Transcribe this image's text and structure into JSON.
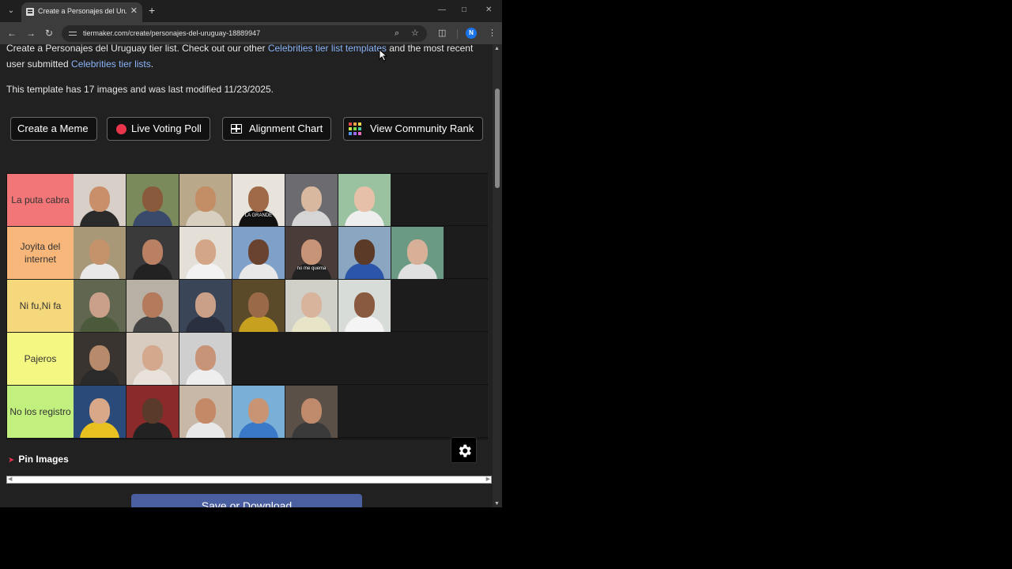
{
  "browser": {
    "tab_title": "Create a Personajes del Uruguay",
    "url": "tiermaker.com/create/personajes-del-uruguay-18889947",
    "profile_initial": "N"
  },
  "page": {
    "intro_lead": "Create a Personajes del Uruguay tier list. Check out our other ",
    "intro_link1": "Celebrities tier list templates",
    "intro_mid": " and the most recent user submitted ",
    "intro_link2": "Celebrities tier lists",
    "intro_end": ".",
    "template_info": "This template has 17 images and was last modified 11/23/2025."
  },
  "buttons": {
    "meme": "Create a Meme",
    "poll": "Live Voting Poll",
    "alignment": "Alignment Chart",
    "rank": "View Community Rank"
  },
  "tiers": [
    {
      "label": "La puta cabra",
      "color": "#f27577",
      "tiles": [
        {
          "bg": "#d8d0c8",
          "skin": "#c98f6a",
          "shirt": "#2a2a2a"
        },
        {
          "bg": "#7a8a5a",
          "skin": "#8a5a3c",
          "shirt": "#3a4a6a"
        },
        {
          "bg": "#b9a88a",
          "skin": "#c38d66",
          "shirt": "#d8cfc0"
        },
        {
          "bg": "#e8e4dc",
          "skin": "#a06a48",
          "shirt": "#111111",
          "caption": "LA GRANDE"
        },
        {
          "bg": "#6c6c70",
          "skin": "#d9b8a0",
          "shirt": "#d5d5d5"
        },
        {
          "bg": "#9ac2a0",
          "skin": "#e6c0a8",
          "shirt": "#eeeeee"
        }
      ]
    },
    {
      "label": "Joyita del internet",
      "color": "#f7b67a",
      "tiles": [
        {
          "bg": "#a89878",
          "skin": "#c4936c",
          "shirt": "#e8e8e8"
        },
        {
          "bg": "#3a3a3a",
          "skin": "#b98064",
          "shirt": "#222222"
        },
        {
          "bg": "#e4e0d8",
          "skin": "#d2a686",
          "shirt": "#f2f2f2"
        },
        {
          "bg": "#7fa0c8",
          "skin": "#6a4230",
          "shirt": "#e8e8e8"
        },
        {
          "bg": "#4a3c38",
          "skin": "#c89478",
          "shirt": "#222222",
          "caption": "no me quema"
        },
        {
          "bg": "#8aa6c0",
          "skin": "#5c3a28",
          "shirt": "#2a55a8"
        },
        {
          "bg": "#6a9a84",
          "skin": "#d8b098",
          "shirt": "#e0e0e0"
        }
      ]
    },
    {
      "label": "Ni fu,Ni fa",
      "color": "#f5d87c",
      "tiles": [
        {
          "bg": "#606650",
          "skin": "#caa08a",
          "shirt": "#4a5a3a"
        },
        {
          "bg": "#b8b0a4",
          "skin": "#b47a5c",
          "shirt": "#444444"
        },
        {
          "bg": "#3a4658",
          "skin": "#caa088",
          "shirt": "#2a3040"
        },
        {
          "bg": "#5a4a2a",
          "skin": "#9a6a48",
          "shirt": "#c8a020"
        },
        {
          "bg": "#d0d0c8",
          "skin": "#d8b49c",
          "shirt": "#e8e4c8"
        },
        {
          "bg": "#d8dcd8",
          "skin": "#8a5a40",
          "shirt": "#f4f4f4"
        }
      ]
    },
    {
      "label": "Pajeros",
      "color": "#f4f782",
      "tiles": [
        {
          "bg": "#3a3430",
          "skin": "#b88a6c",
          "shirt": "#2a2a2a"
        },
        {
          "bg": "#d8ccc0",
          "skin": "#d4a88c",
          "shirt": "#e8e2da"
        },
        {
          "bg": "#cfcfcf",
          "skin": "#c89478",
          "shirt": "#eeeeee"
        }
      ]
    },
    {
      "label": "No los registro",
      "color": "#c2f07e",
      "tiles": [
        {
          "bg": "#2a4a7a",
          "skin": "#d8a888",
          "shirt": "#e8c020"
        },
        {
          "bg": "#8a2a2a",
          "skin": "#5a3a2a",
          "shirt": "#222222"
        },
        {
          "bg": "#c8b8a8",
          "skin": "#c48a68",
          "shirt": "#e8e8e8"
        },
        {
          "bg": "#7ab0d8",
          "skin": "#c89474",
          "shirt": "#3a78c8"
        },
        {
          "bg": "#5a5048",
          "skin": "#c08a6c",
          "shirt": "#3a3a3a"
        }
      ]
    }
  ],
  "pin_images": "Pin Images",
  "save_button": "Save or Download",
  "colors": {
    "page_bg": "#212121",
    "link": "#8ab4f8",
    "record_dot": "#e8354c",
    "save_button": "#4a5f9f"
  },
  "icons": [
    "tab-search-icon",
    "favicon-icon",
    "close-icon",
    "plus-icon",
    "minimize-icon",
    "maximize-icon",
    "back-icon",
    "forward-icon",
    "reload-icon",
    "site-info-icon",
    "zoom-icon",
    "star-icon",
    "extensions-icon",
    "menu-icon",
    "record-dot-icon",
    "grid-icon",
    "rank-grid-icon",
    "pin-icon",
    "gear-icon",
    "cursor-icon"
  ]
}
